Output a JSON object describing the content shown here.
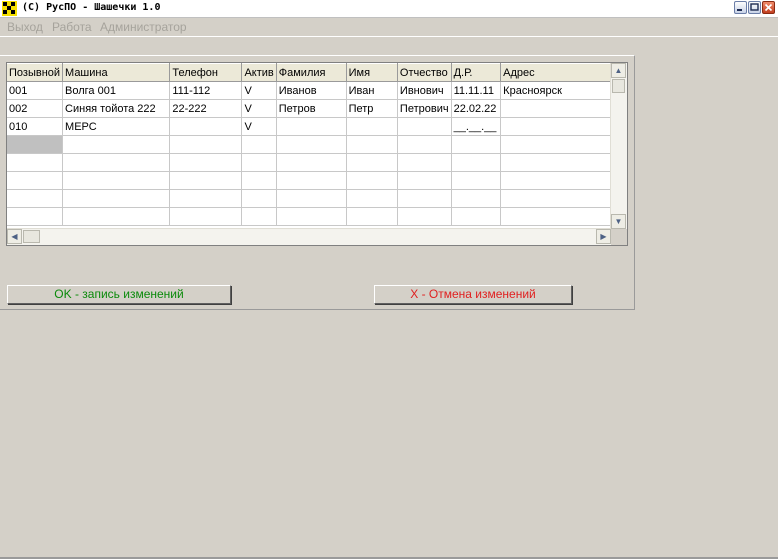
{
  "window": {
    "title": "(C) РусПО - Шашечки 1.0",
    "icon": "checkered-flag-icon",
    "controls": [
      "minimize-icon",
      "maximize-icon",
      "close-icon"
    ]
  },
  "menu": [
    "Выход",
    "Работа",
    "Администратор"
  ],
  "grid": {
    "columns": [
      "Позывной",
      "Машина",
      "Телефон",
      "Актив",
      "Фамилия",
      "Имя",
      "Отчество",
      "Д.Р.",
      "Адрес"
    ],
    "rows": [
      [
        "001",
        "Волга 001",
        "111-112",
        "V",
        "Иванов",
        "Иван",
        "Ивнович",
        "11.11.11",
        "Красноярск"
      ],
      [
        "002",
        "Синяя тойота 222",
        "22-222",
        "V",
        "Петров",
        "Петр",
        "Петрович",
        "22.02.22",
        ""
      ],
      [
        "010",
        "МЕРС",
        "",
        "V",
        "",
        "",
        "",
        "__.__.__",
        ""
      ],
      [
        "",
        "",
        "",
        "",
        "",
        "",
        "",
        "",
        ""
      ],
      [
        "",
        "",
        "",
        "",
        "",
        "",
        "",
        "",
        ""
      ],
      [
        "",
        "",
        "",
        "",
        "",
        "",
        "",
        "",
        ""
      ],
      [
        "",
        "",
        "",
        "",
        "",
        "",
        "",
        "",
        ""
      ],
      [
        "",
        "",
        "",
        "",
        "",
        "",
        "",
        "",
        ""
      ]
    ]
  },
  "buttons": {
    "ok": "OK - запись изменений",
    "cancel": "X - Отмена изменений"
  },
  "colors": {
    "ok_text": "#0a8a0a",
    "cancel_text": "#e02020",
    "menu_disabled": "#a6a39c"
  }
}
